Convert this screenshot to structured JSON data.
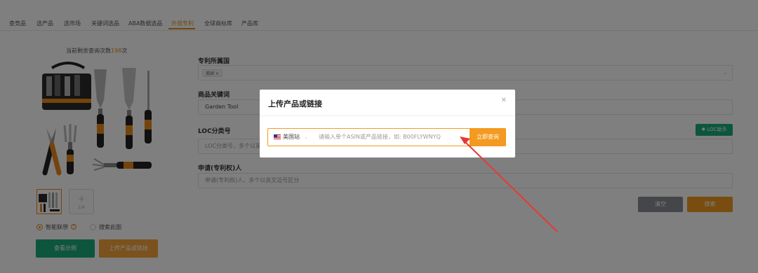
{
  "nav": {
    "tabs": [
      {
        "label": "查竞品"
      },
      {
        "label": "选产品"
      },
      {
        "label": "选市场"
      },
      {
        "label": "关键词选品"
      },
      {
        "label": "ABA数据选品"
      },
      {
        "label": "外观专利"
      },
      {
        "label": "全球商标库"
      },
      {
        "label": "产品库"
      }
    ],
    "active_index": 5
  },
  "left": {
    "remaining_prefix": "当前剩余查询次数",
    "remaining_count": "198",
    "remaining_suffix": "次",
    "add_count": "1/4",
    "radio_smart": "智能联想",
    "radio_search_image": "搜索此图",
    "btn_example": "查看示例",
    "btn_upload": "上传产品或链接"
  },
  "form": {
    "country_label": "专利所属国",
    "country_tag": "美国",
    "keyword_label": "商品关键词",
    "keyword_value": "Garden Tool",
    "loc_label": "LOC分类号",
    "loc_placeholder": "LOC分类号，多个以英文逗号区分",
    "loc_helper": "LOC助手",
    "applicant_label": "申请(专利权)人",
    "applicant_placeholder": "申请(专利权)人，多个以英文逗号区分",
    "btn_clear": "清空",
    "btn_search": "搜索"
  },
  "modal": {
    "title": "上传产品或链接",
    "site": "美国站",
    "placeholder": "请输入单个ASIN或产品链接，如: B00FLYWNYQ",
    "btn_query": "立即查询"
  },
  "colors": {
    "accent": "#f39a20",
    "green": "#1aad7b",
    "arrow": "#e53935"
  }
}
